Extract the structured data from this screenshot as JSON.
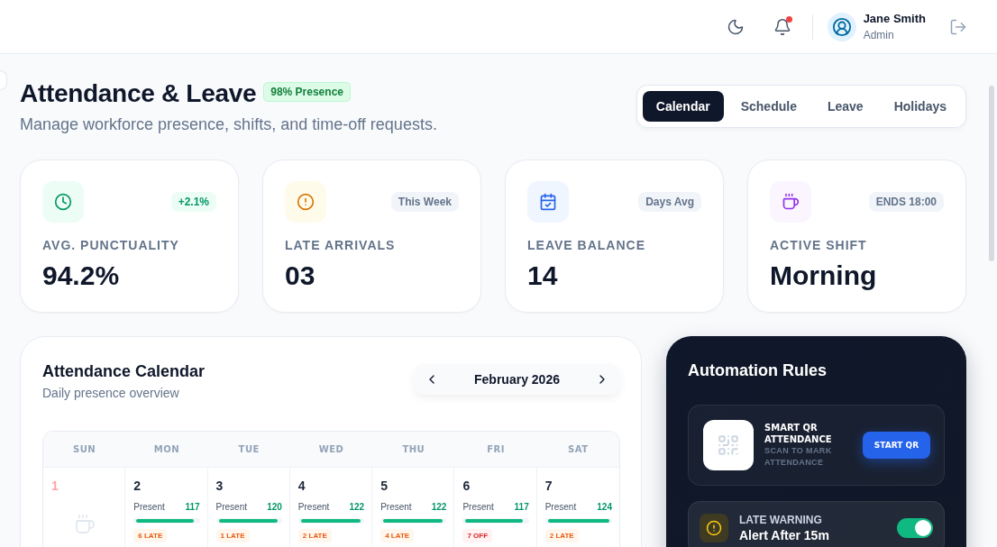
{
  "top_bar": {
    "notifications": {
      "unread": true
    },
    "user": {
      "name": "Jane Smith",
      "role": "Admin"
    }
  },
  "header": {
    "title": "Attendance & Leave",
    "badge": "98% Presence",
    "subtitle": "Manage workforce presence, shifts, and time-off requests."
  },
  "tabs": [
    {
      "label": "Calendar",
      "selected": true
    },
    {
      "label": "Schedule",
      "selected": false
    },
    {
      "label": "Leave",
      "selected": false
    },
    {
      "label": "Holidays",
      "selected": false
    }
  ],
  "stats": [
    {
      "kind": "punctuality",
      "badge": "+2.1%",
      "positive": true,
      "label": "AVG. PUNCTUALITY",
      "value": "94.2%"
    },
    {
      "kind": "late",
      "badge": "This Week",
      "positive": false,
      "label": "LATE ARRIVALS",
      "value": "03"
    },
    {
      "kind": "leave",
      "badge": "Days Avg",
      "positive": false,
      "label": "LEAVE BALANCE",
      "value": "14"
    },
    {
      "kind": "shift",
      "badge": "ENDS 18:00",
      "positive": false,
      "label": "ACTIVE SHIFT",
      "value": "Morning"
    }
  ],
  "calendar": {
    "title": "Attendance Calendar",
    "subtitle": "Daily presence overview",
    "month": "February 2026",
    "weekdays": [
      "SUN",
      "MON",
      "TUE",
      "WED",
      "THU",
      "FRI",
      "SAT"
    ],
    "days": [
      {
        "date": "1",
        "kind": "weekend"
      },
      {
        "date": "2",
        "kind": "workday",
        "present_label": "Present",
        "present": "117",
        "level": 0.94,
        "tag": {
          "kind": "late",
          "text": "6 LATE"
        }
      },
      {
        "date": "3",
        "kind": "workday",
        "present_label": "Present",
        "present": "120",
        "level": 0.97,
        "tag": {
          "kind": "late",
          "text": "1 LATE"
        }
      },
      {
        "date": "4",
        "kind": "workday",
        "present_label": "Present",
        "present": "122",
        "level": 0.98,
        "tag": {
          "kind": "late",
          "text": "2 LATE"
        }
      },
      {
        "date": "5",
        "kind": "workday",
        "present_label": "Present",
        "present": "122",
        "level": 0.98,
        "tag": {
          "kind": "late",
          "text": "4 LATE"
        }
      },
      {
        "date": "6",
        "kind": "workday",
        "present_label": "Present",
        "present": "117",
        "level": 0.94,
        "tag": {
          "kind": "off",
          "text": "7 OFF"
        }
      },
      {
        "date": "7",
        "kind": "workday",
        "present_label": "Present",
        "present": "124",
        "level": 1,
        "tag": {
          "kind": "late",
          "text": "2 LATE"
        }
      }
    ]
  },
  "automation": {
    "title": "Automation Rules",
    "rules": [
      {
        "kind": "qr",
        "title": "SMART QR ATTENDANCE",
        "subtitle": "SCAN TO MARK ATTENDANCE",
        "action": "START QR"
      },
      {
        "kind": "toggle",
        "label": "LATE WARNING",
        "value": "Alert After 15m",
        "on": true
      }
    ]
  }
}
